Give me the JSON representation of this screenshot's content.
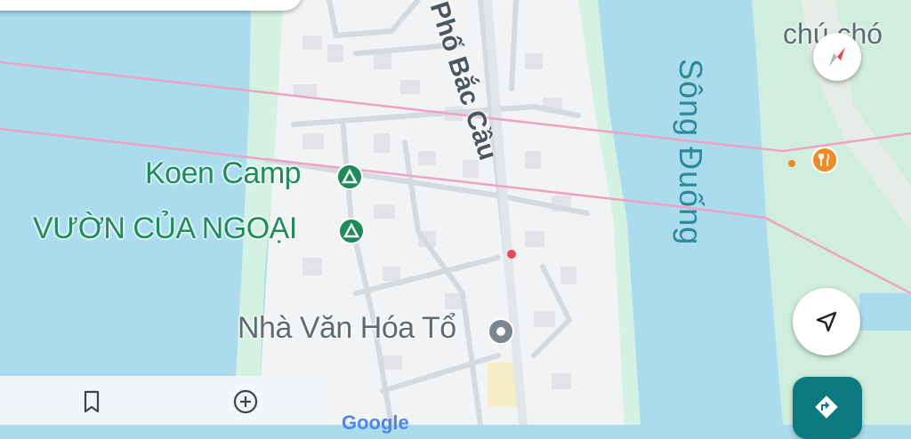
{
  "map": {
    "labels": {
      "koen_camp": "Koen Camp",
      "vuon_cua_ngoai": "VƯỜN CỦA NGOẠI",
      "nha_van_hoa": "Nhà Văn Hóa Tổ",
      "pho_bac_cau": "Phố Bắc Cầu",
      "song_duong": "Sông Đuống",
      "chu_cho": "chú chó",
      "google": "Google"
    },
    "icons": {
      "camp": "campground-icon",
      "landmark": "landmark-pin-icon",
      "restaurant": "restaurant-icon",
      "compass": "compass-icon",
      "my_location": "navigation-arrow-icon",
      "directions": "directions-icon",
      "saved": "bookmark-icon",
      "contribute": "add-circle-icon"
    },
    "colors": {
      "water": "#aadcee",
      "land": "#f2f3f5",
      "green_bank": "#d3f2e1",
      "park": "#cfeedd",
      "rail_line": "#f0a3c0",
      "poi_green": "#1e8c5a",
      "directions_bg": "#0b7a80"
    }
  },
  "bottom_nav": {
    "saved_icon": "bookmark-icon",
    "contribute_icon": "add-circle-icon"
  }
}
